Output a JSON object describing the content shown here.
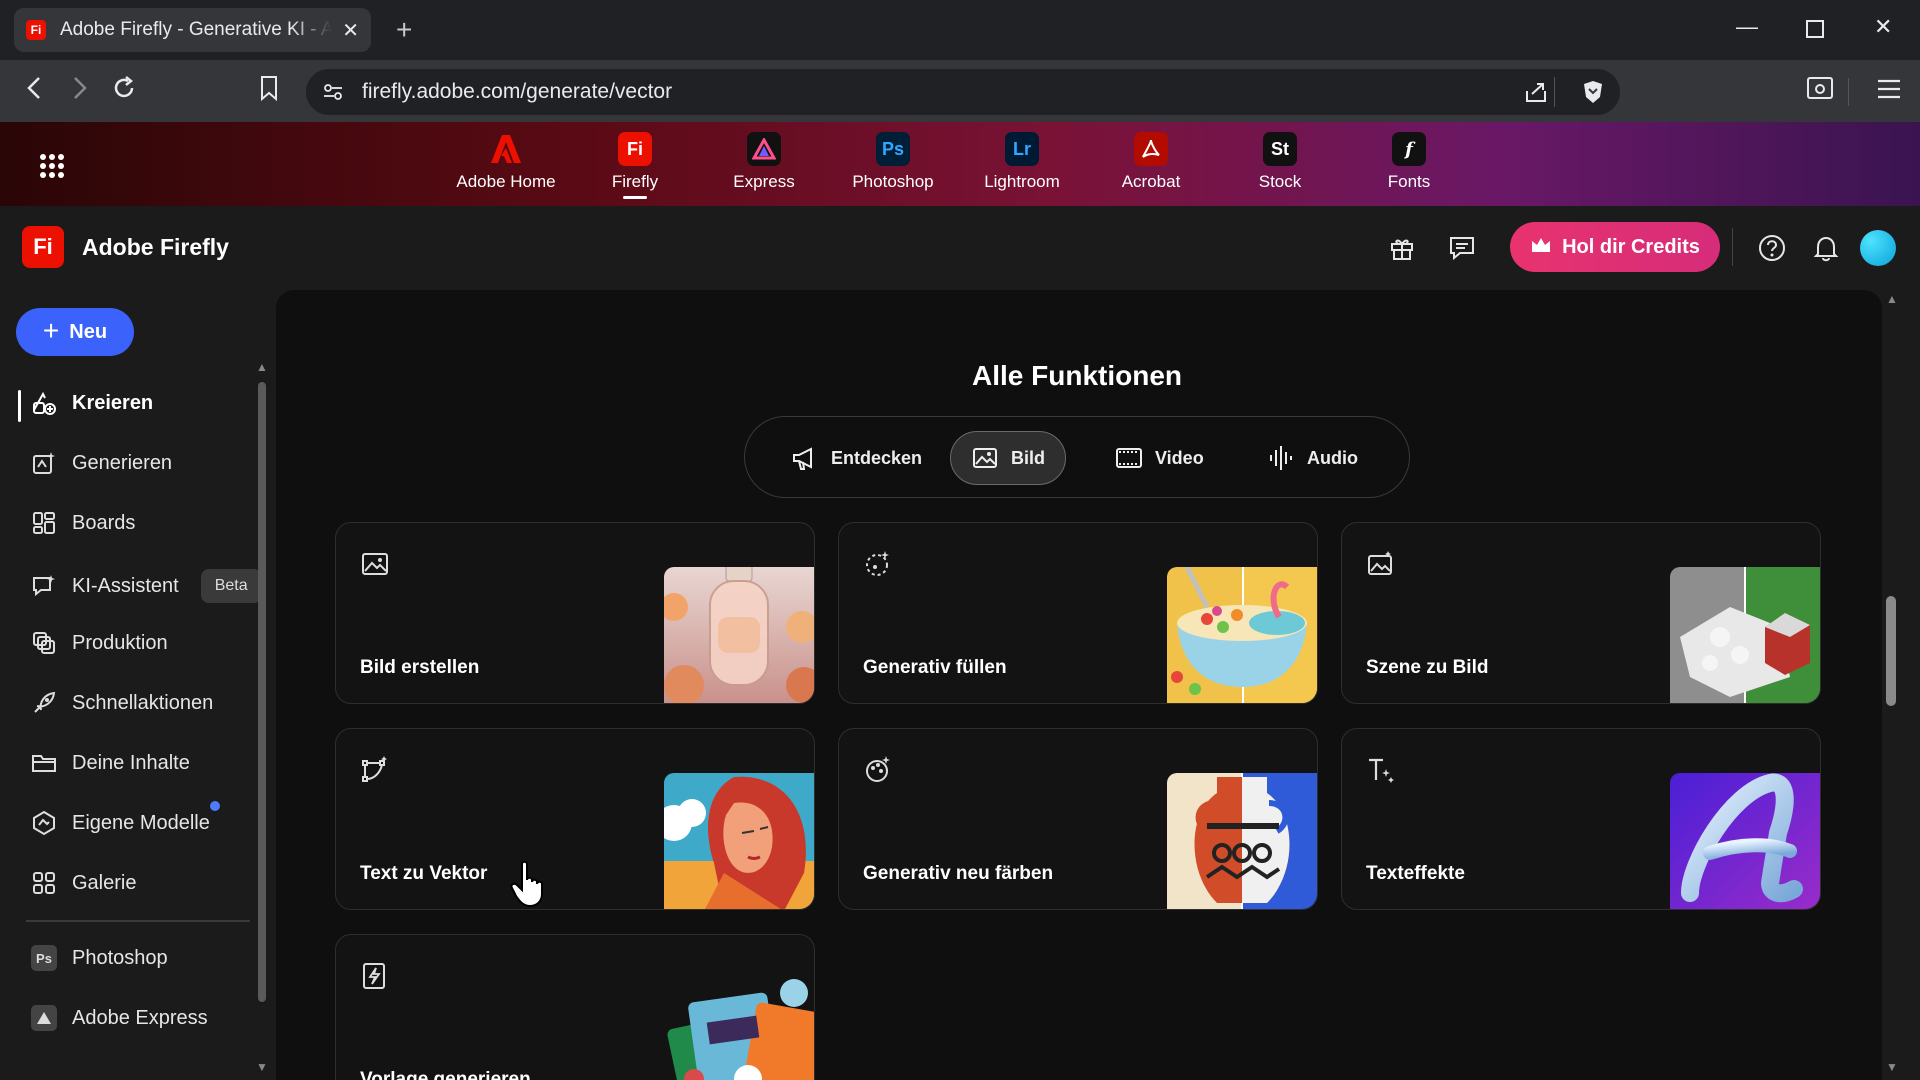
{
  "browser": {
    "tab_title": "Adobe Firefly - Generative KI - Al",
    "favicon_text": "Fi",
    "url": "firefly.adobe.com/generate/vector"
  },
  "appbar": {
    "apps": [
      {
        "label": "Adobe Home",
        "icon": "adobe-logo",
        "color": "#eb1000"
      },
      {
        "label": "Firefly",
        "icon_text": "Fi",
        "color": "#eb1000",
        "active": true
      },
      {
        "label": "Express",
        "icon": "express-logo",
        "color": "#111"
      },
      {
        "label": "Photoshop",
        "icon_text": "Ps",
        "color": "#001e36"
      },
      {
        "label": "Lightroom",
        "icon_text": "Lr",
        "color": "#001a33"
      },
      {
        "label": "Acrobat",
        "icon": "acrobat-logo",
        "color": "#b30b00"
      },
      {
        "label": "Stock",
        "icon_text": "St",
        "color": "#111"
      },
      {
        "label": "Fonts",
        "icon_text": "f",
        "color": "#111"
      }
    ]
  },
  "header": {
    "logo_text": "Fi",
    "title": "Adobe Firefly",
    "credits_label": "Hol dir Credits"
  },
  "sidebar": {
    "new_label": "Neu",
    "items": [
      {
        "label": "Kreieren",
        "icon": "create-icon",
        "active": true
      },
      {
        "label": "Generieren",
        "icon": "generate-icon"
      },
      {
        "label": "Boards",
        "icon": "boards-icon"
      },
      {
        "label": "KI-Assistent",
        "icon": "ai-assistant-icon",
        "badge": "Beta"
      },
      {
        "label": "Produktion",
        "icon": "production-icon"
      },
      {
        "label": "Schnellaktionen",
        "icon": "quick-actions-icon"
      },
      {
        "label": "Deine Inhalte",
        "icon": "folder-icon"
      },
      {
        "label": "Eigene Modelle",
        "icon": "custom-models-icon"
      },
      {
        "label": "Galerie",
        "icon": "gallery-icon"
      },
      {
        "label": "Photoshop",
        "icon_text": "Ps"
      },
      {
        "label": "Adobe Express",
        "icon": "express-icon"
      }
    ]
  },
  "main": {
    "title": "Alle Funktionen",
    "tabs": [
      {
        "label": "Entdecken",
        "icon": "megaphone-icon"
      },
      {
        "label": "Bild",
        "icon": "image-icon",
        "selected": true
      },
      {
        "label": "Video",
        "icon": "video-icon"
      },
      {
        "label": "Audio",
        "icon": "audio-icon"
      }
    ],
    "cards": [
      {
        "label": "Bild erstellen",
        "icon": "image-icon"
      },
      {
        "label": "Generativ füllen",
        "icon": "generative-fill-icon"
      },
      {
        "label": "Szene zu Bild",
        "icon": "scene-icon"
      },
      {
        "label": "Text zu Vektor",
        "icon": "vector-icon"
      },
      {
        "label": "Generativ neu färben",
        "icon": "recolor-icon"
      },
      {
        "label": "Texteffekte",
        "icon": "text-effects-icon"
      },
      {
        "label": "Vorlage generieren",
        "icon": "template-icon"
      }
    ]
  }
}
